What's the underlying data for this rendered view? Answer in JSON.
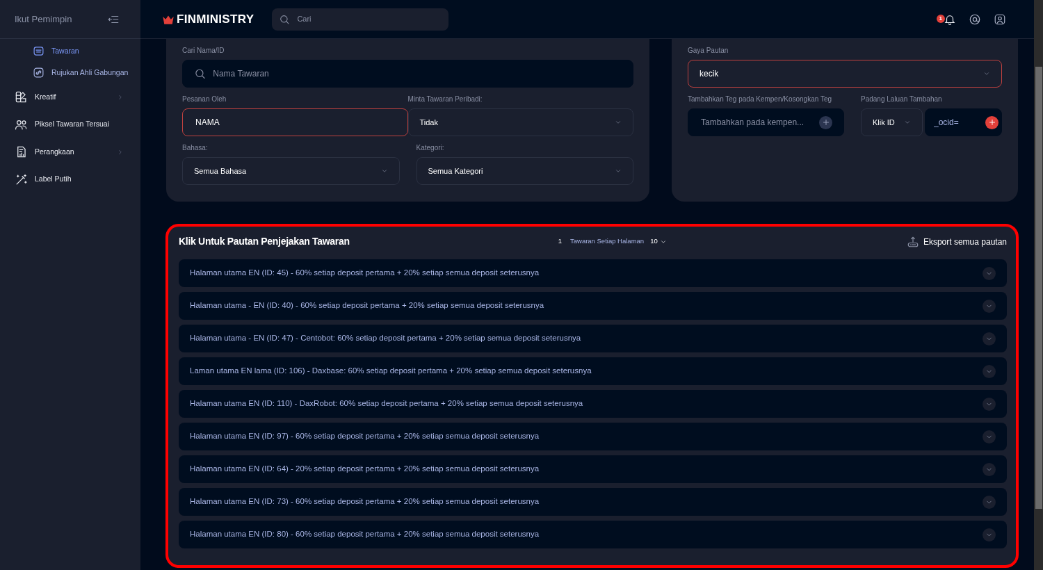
{
  "sidebar": {
    "title": "Ikut Pemimpin",
    "items": [
      {
        "kind": "sub",
        "label": "Tawaran",
        "selected": true,
        "has_submenu": false
      },
      {
        "kind": "sub",
        "label": "Rujukan Ahli Gabungan",
        "selected": false,
        "has_submenu": false
      },
      {
        "kind": "main",
        "label": "Kreatif",
        "selected": false,
        "has_submenu": true
      },
      {
        "kind": "main",
        "label": "Piksel Tawaran Tersuai",
        "selected": false,
        "has_submenu": false
      },
      {
        "kind": "main",
        "label": "Perangkaan",
        "selected": false,
        "has_submenu": true
      },
      {
        "kind": "main",
        "label": "Label Putih",
        "selected": false,
        "has_submenu": false
      }
    ]
  },
  "header": {
    "logo": "FINMINISTRY",
    "search": {
      "placeholder": "Cari"
    },
    "notification_count": "1"
  },
  "left_form": {
    "rows": [
      [
        {
          "kind": "search",
          "label": "Cari Nama/ID",
          "placeholder": "Nama Tawaran",
          "active": false
        }
      ],
      [
        {
          "kind": "input",
          "label": "Pesanan Oleh",
          "value": "NAMA",
          "active": true
        },
        {
          "kind": "select",
          "label": "Minta Tawaran Peribadi:",
          "value": "Tidak",
          "active": false
        }
      ],
      [
        {
          "kind": "select",
          "label": "Bahasa:",
          "value": "Semua Bahasa",
          "active": false
        },
        {
          "kind": "select",
          "label": "Kategori:",
          "value": "Semua Kategori",
          "active": false
        }
      ]
    ]
  },
  "right_form": {
    "link_style": {
      "label": "Gaya Pautan",
      "value": "kecik",
      "active": true
    },
    "tags": {
      "label": "Tambahkan Teg pada Kempen/Kosongkan Teg",
      "placeholder": "Tambahkan pada kempen..."
    },
    "path": {
      "label": "Padang Laluan Tambahan",
      "select": "Klik ID",
      "value": "_ocid="
    }
  },
  "links_section": {
    "title": "Klik Untuk Pautan Penjejakan Tawaran",
    "highlighted": true,
    "page": "1",
    "per_page_label": "Tawaran Setiap Halaman",
    "per_page": "10",
    "export": "Eksport semua pautan",
    "rows": [
      {
        "text": "Halaman utama EN (ID: 45) - 60% setiap deposit pertama + 20% setiap semua deposit seterusnya",
        "expanded": false
      },
      {
        "text": "Halaman utama - EN (ID: 40) - 60% setiap deposit pertama + 20% setiap semua deposit seterusnya",
        "expanded": false
      },
      {
        "text": "Halaman utama - EN (ID: 47) - Centobot: 60% setiap deposit pertama + 20% setiap semua deposit seterusnya",
        "expanded": false
      },
      {
        "text": "Laman utama EN lama (ID: 106) - Daxbase: 60% setiap deposit pertama + 20% setiap semua deposit seterusnya",
        "expanded": false
      },
      {
        "text": "Halaman utama EN (ID: 110) - DaxRobot: 60% setiap deposit pertama + 20% setiap semua deposit seterusnya",
        "expanded": false
      },
      {
        "text": "Halaman utama EN (ID: 97) - 60% setiap deposit pertama + 20% setiap semua deposit seterusnya",
        "expanded": false
      },
      {
        "text": "Halaman utama EN (ID: 64) - 20% setiap deposit pertama + 20% setiap semua deposit seterusnya",
        "expanded": false
      },
      {
        "text": "Halaman utama EN (ID: 73) - 60% setiap deposit pertama + 20% setiap semua deposit seterusnya",
        "expanded": false
      },
      {
        "text": "Halaman utama EN (ID: 80) - 60% setiap deposit pertama + 20% setiap semua deposit seterusnya",
        "expanded": false
      }
    ]
  }
}
